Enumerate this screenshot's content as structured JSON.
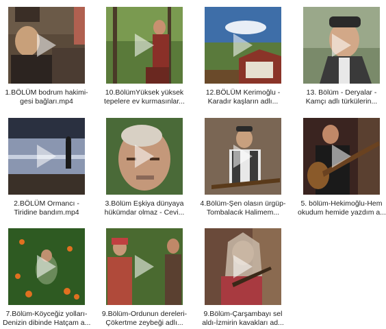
{
  "videos": [
    {
      "line1": "1.BÖLÜM bodrum hakimi-",
      "line2": "gesi bağları.mp4",
      "icon": "video-file"
    },
    {
      "line1": "10.BölümYüksek yüksek",
      "line2": "tepelere ev kurmasınlar...",
      "icon": "video-file"
    },
    {
      "line1": "12.BÖLÜM Kerimoğlu -",
      "line2": "Karadır kaşların adlı...",
      "icon": "video-file"
    },
    {
      "line1": "13. Bölüm - Deryalar -",
      "line2": "Kamçı adlı türkülerin...",
      "icon": "video-file"
    },
    {
      "line1": "2.BÖLÜM Ormancı -",
      "line2": "Tiridine bandım.mp4",
      "icon": "video-file"
    },
    {
      "line1": "3.Bölüm Eşkiya dünyaya",
      "line2": "hükümdar olmaz - Cevi...",
      "icon": "video-file"
    },
    {
      "line1": "4.Bölüm-Şen olasın ürgüp-",
      "line2": "Tombalacık Halimem...",
      "icon": "video-file"
    },
    {
      "line1": "5. bölüm-Hekimoğlu-Hem",
      "line2": "okudum hemide yazdım a...",
      "icon": "video-file"
    },
    {
      "line1": "7.Bölüm-Köyceğiz yolları-",
      "line2": "Denizin dibinde Hatçam a...",
      "icon": "video-file"
    },
    {
      "line1": "9.Bölüm-Ordunun dereleri-",
      "line2": "Çökertme zeybeği adlı...",
      "icon": "video-file"
    },
    {
      "line1": "9.Bölüm-Çarşambayı sel",
      "line2": "aldı-İzmirin kavakları ad...",
      "icon": "video-file"
    }
  ],
  "colors": {
    "play_overlay": "#ffffff",
    "caption_text": "#222222",
    "background": "#ffffff"
  }
}
